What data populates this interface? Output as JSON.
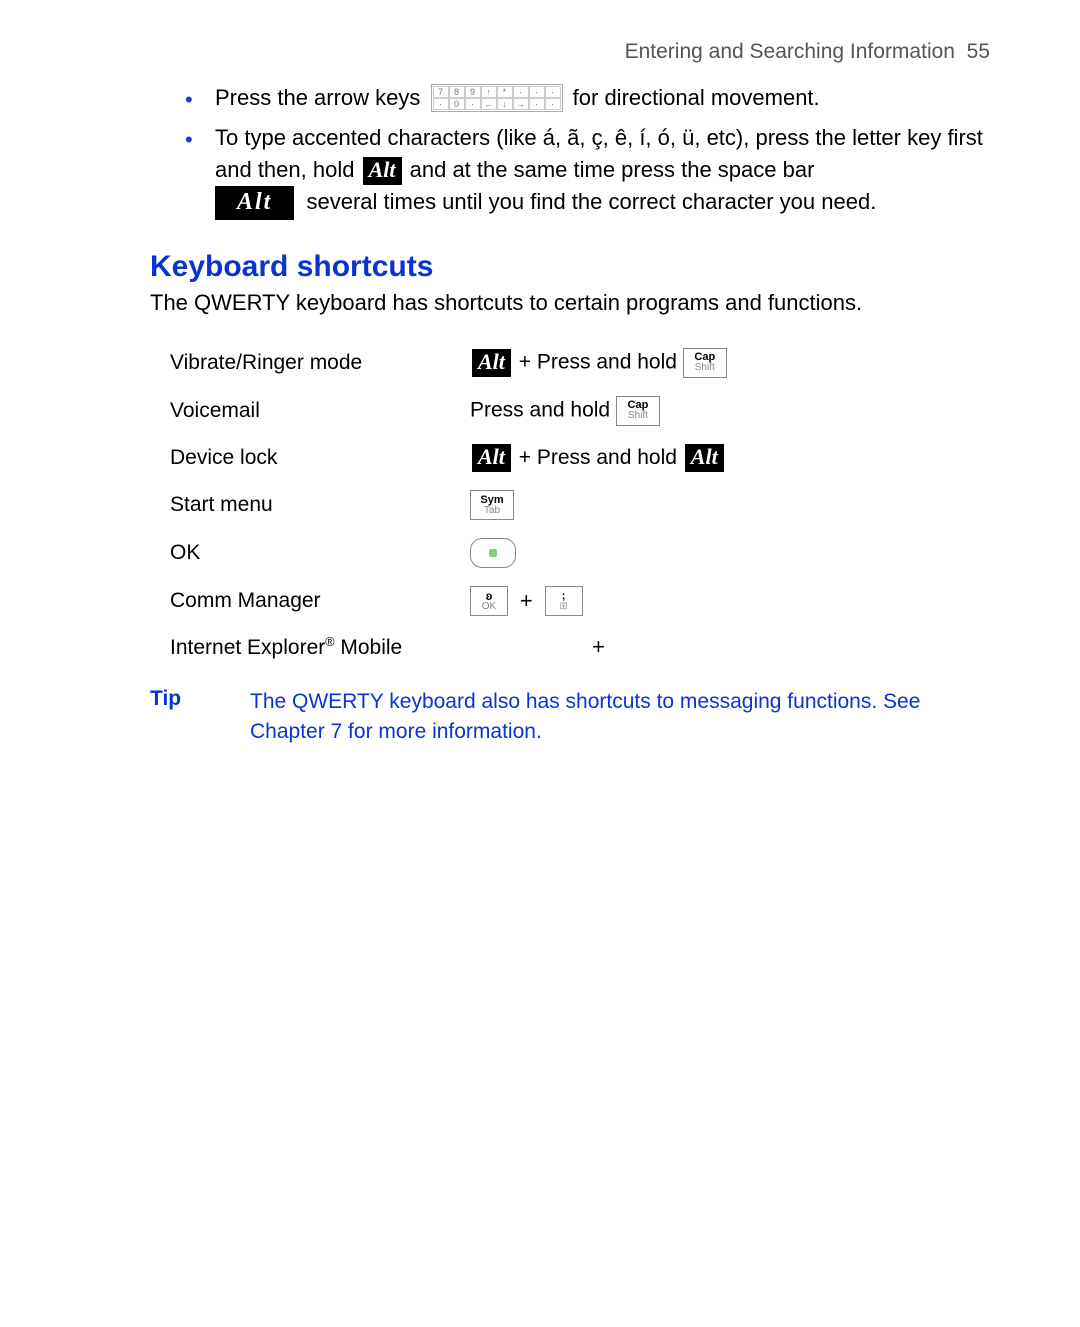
{
  "header": {
    "running_title": "Entering and Searching Information",
    "page_number": "55"
  },
  "bullets": {
    "b1_a": "Press the arrow keys",
    "b1_b": "for directional movement.",
    "b2_a": "To type accented characters (like á, ã, ç, ê, í, ó, ü, etc), press the letter key first and then, hold",
    "b2_b": "and at the same time press the space bar",
    "b2_c": "several times until you find the correct character you need."
  },
  "section": {
    "title": "Keyboard shortcuts",
    "intro": "The QWERTY keyboard has shortcuts to certain programs and functions."
  },
  "shortcuts": {
    "r1_label": "Vibrate/Ringer mode",
    "r1_mid": "+ Press and hold",
    "r2_label": "Voicemail",
    "r2_text": "Press and hold",
    "r3_label": "Device lock",
    "r3_mid": "+ Press and hold",
    "r4_label": "Start menu",
    "r5_label": "OK",
    "r6_label": "Comm Manager",
    "r6_plus": "+",
    "r7_label_a": "Internet Explorer",
    "r7_label_b": " Mobile",
    "r7_plus": "+"
  },
  "keys": {
    "alt": "Alt",
    "cap": "Cap",
    "shift": "Shift",
    "sym": "Sym",
    "tab": "Tab",
    "ok": "OK",
    "semicolon": ";"
  },
  "tip": {
    "label": "Tip",
    "body": "The QWERTY keyboard also has shortcuts to messaging functions. See Chapter 7 for more information."
  }
}
